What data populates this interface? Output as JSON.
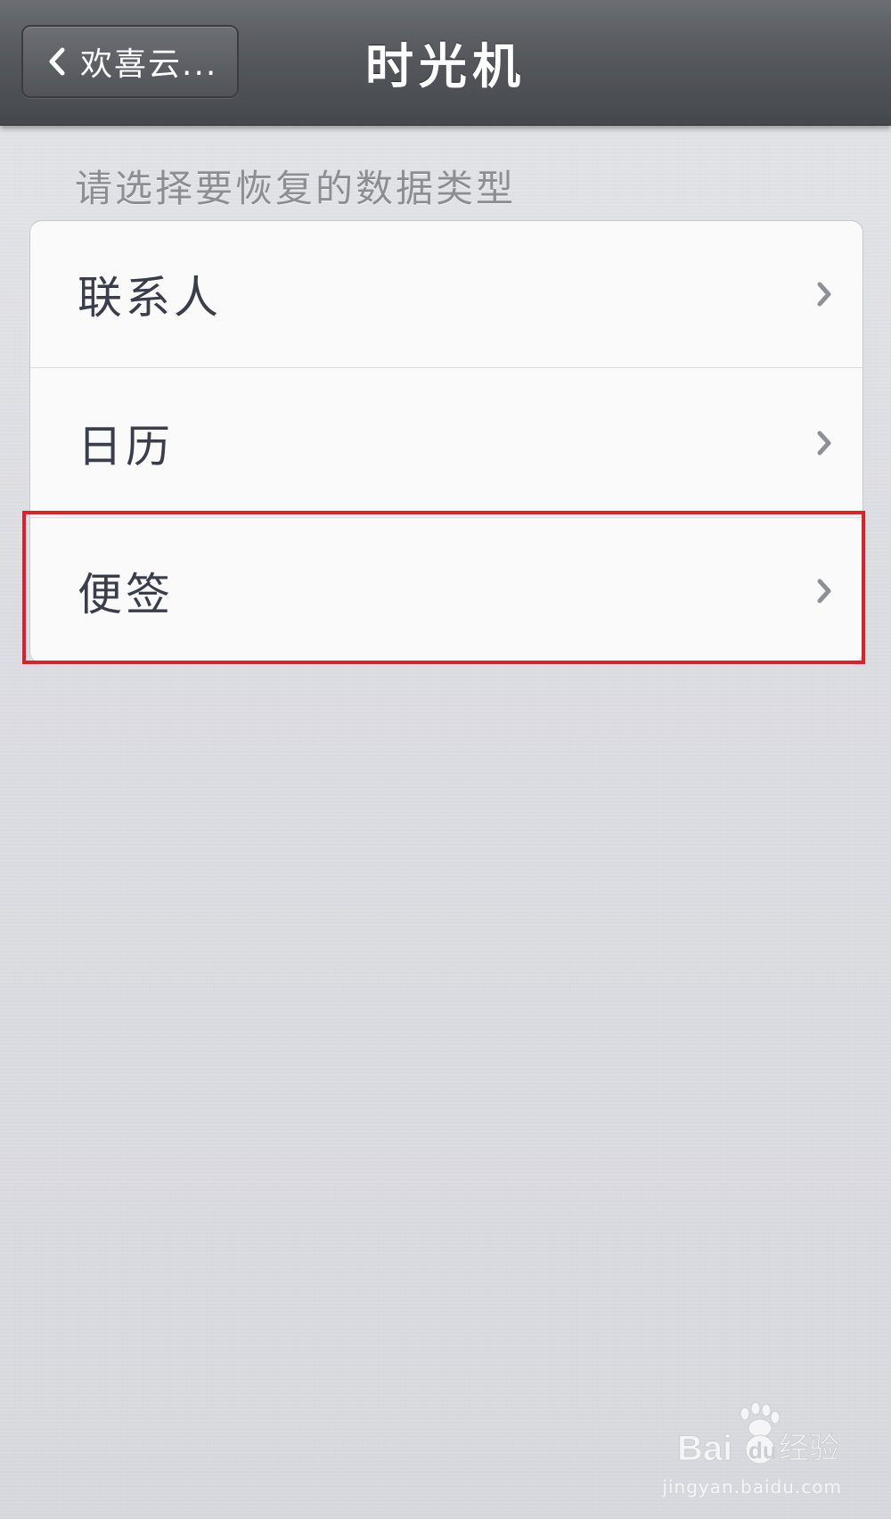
{
  "navbar": {
    "back_label": "欢喜云...",
    "title": "时光机"
  },
  "section": {
    "header": "请选择要恢复的数据类型"
  },
  "list": {
    "items": [
      {
        "label": "联系人"
      },
      {
        "label": "日历"
      },
      {
        "label": "便签"
      }
    ]
  },
  "highlight": {
    "color": "#e01e2c",
    "target": "便签"
  },
  "watermark": {
    "logo_text": "Baidu经验",
    "url": "jingyan.baidu.com"
  },
  "icons": {
    "back": "chevron-left-icon",
    "row": "chevron-right-icon"
  }
}
